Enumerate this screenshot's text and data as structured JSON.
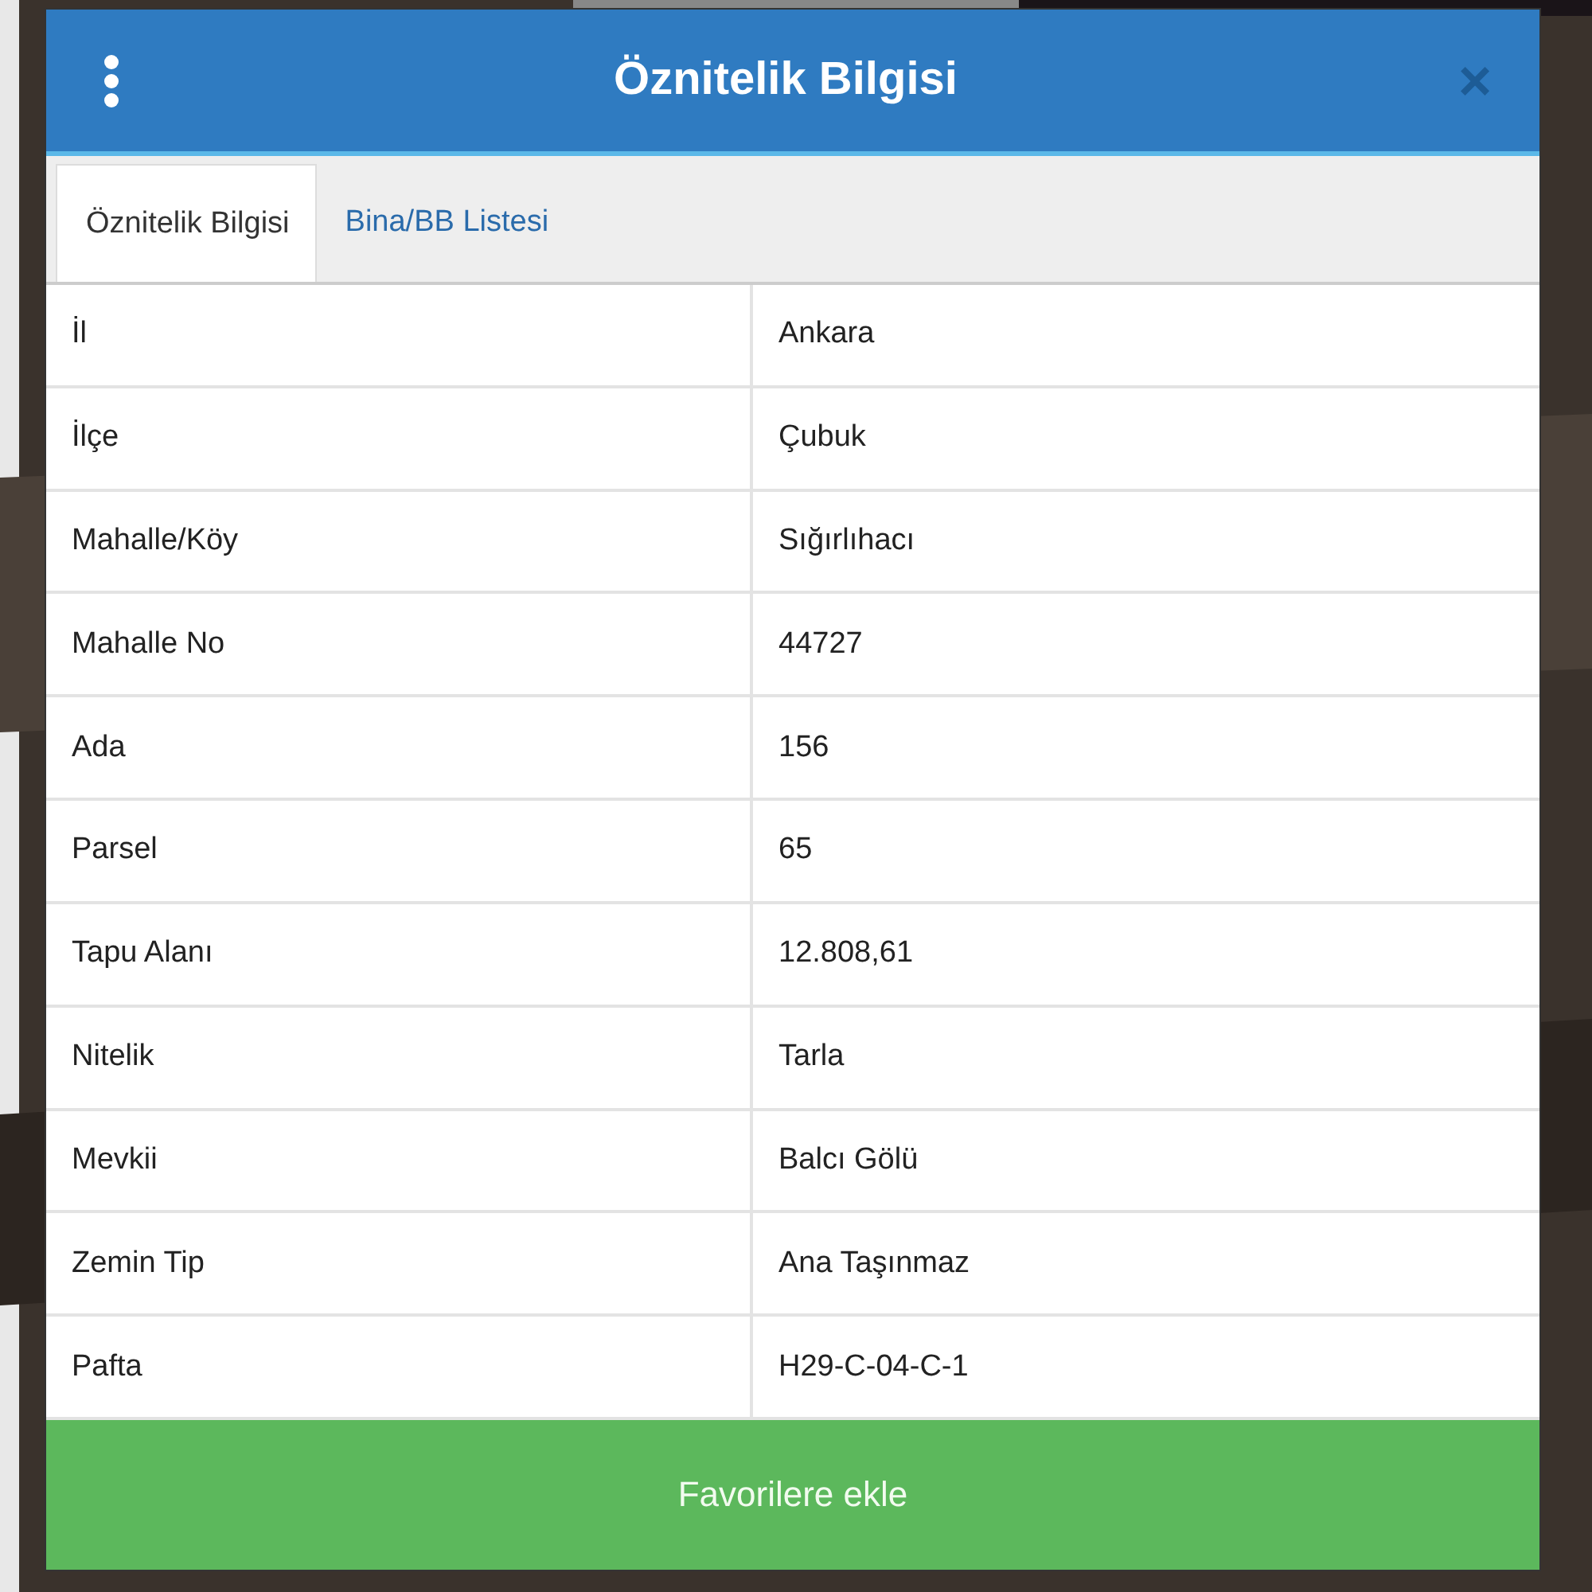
{
  "dialog": {
    "title": "Öznitelik Bilgisi",
    "close": "×"
  },
  "tabs": [
    {
      "label": "Öznitelik Bilgisi",
      "selected": true
    },
    {
      "label": "Bina/BB Listesi",
      "selected": false
    }
  ],
  "rows": [
    {
      "label": "İl",
      "value": "Ankara"
    },
    {
      "label": "İlçe",
      "value": "Çubuk"
    },
    {
      "label": "Mahalle/Köy",
      "value": "Sığırlıhacı"
    },
    {
      "label": "Mahalle No",
      "value": "44727"
    },
    {
      "label": "Ada",
      "value": "156"
    },
    {
      "label": "Parsel",
      "value": "65"
    },
    {
      "label": "Tapu Alanı",
      "value": "12.808,61"
    },
    {
      "label": "Nitelik",
      "value": "Tarla"
    },
    {
      "label": "Mevkii",
      "value": "Balcı Gölü"
    },
    {
      "label": "Zemin Tip",
      "value": "Ana Taşınmaz"
    },
    {
      "label": "Pafta",
      "value": "H29-C-04-C-1"
    }
  ],
  "action_button": "Favorilere ekle"
}
